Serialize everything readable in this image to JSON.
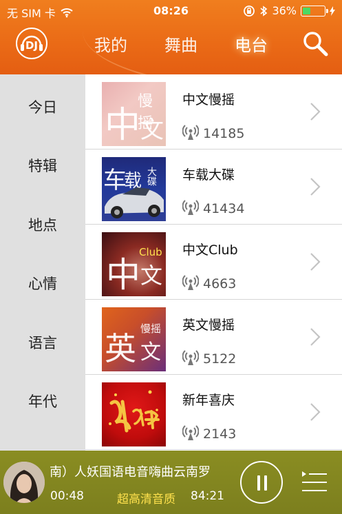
{
  "status_bar": {
    "carrier": "无 SIM 卡",
    "time": "08:26",
    "battery": "36%",
    "battery_level": 0.36
  },
  "header": {
    "logo_text": "DJ",
    "tabs": [
      {
        "label": "我的",
        "active": false
      },
      {
        "label": "舞曲",
        "active": false
      },
      {
        "label": "电台",
        "active": true
      }
    ]
  },
  "sidebar": {
    "items": [
      {
        "label": "今日"
      },
      {
        "label": "特辑"
      },
      {
        "label": "地点"
      },
      {
        "label": "心情"
      },
      {
        "label": "语言"
      },
      {
        "label": "年代"
      }
    ]
  },
  "stations": [
    {
      "name": "中文慢摇",
      "count": "14185",
      "cover_main": "中",
      "cover_sub": "文",
      "cover_tag": "慢摇",
      "cover_theme": "pink"
    },
    {
      "name": "车载大碟",
      "count": "41434",
      "cover_main": "车",
      "cover_sub": "载",
      "cover_tag": "大碟",
      "cover_theme": "blue-car"
    },
    {
      "name": "中文Club",
      "count": "4663",
      "cover_main": "中",
      "cover_sub": "文",
      "cover_tag": "Club",
      "cover_theme": "dark-red"
    },
    {
      "name": "英文慢摇",
      "count": "5122",
      "cover_main": "英",
      "cover_sub": "文",
      "cover_tag": "慢摇",
      "cover_theme": "orange-purple"
    },
    {
      "name": "新年喜庆",
      "count": "2143",
      "cover_main": "",
      "cover_sub": "",
      "cover_tag": "",
      "cover_theme": "red-festive"
    }
  ],
  "player": {
    "song_title": "南）人妖国语电音嗨曲云南罗",
    "elapsed": "00:48",
    "quality": "超高清音质",
    "total": "84:21"
  },
  "colors": {
    "header_orange": "#ea6a16",
    "sidebar_gray": "#e0e0e0",
    "player_olive": "#7c7f1e",
    "quality_yellow": "#ffe14d"
  }
}
